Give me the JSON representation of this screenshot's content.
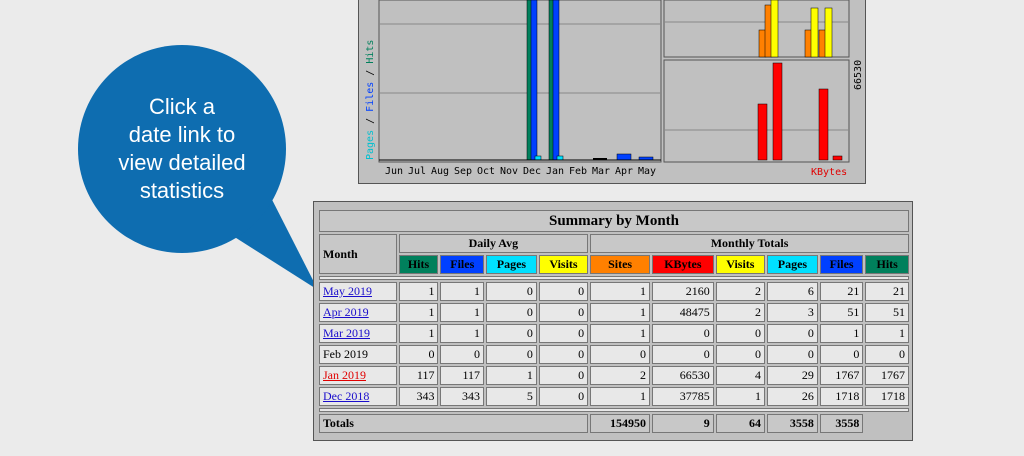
{
  "chart": {
    "y_legend": {
      "pages": "Pages",
      "sep1": " / ",
      "files": "Files",
      "sep2": " / ",
      "hits": "Hits"
    },
    "months": [
      "Jun",
      "Jul",
      "Aug",
      "Sep",
      "Oct",
      "Nov",
      "Dec",
      "Jan",
      "Feb",
      "Mar",
      "Apr",
      "May"
    ],
    "kbytes_label": "KBytes",
    "kbytes_scale": "66530"
  },
  "callout": {
    "line1": "Click a",
    "line2": "date link to",
    "line3": "view detailed",
    "line4": "statistics"
  },
  "summary": {
    "title": "Summary by Month",
    "month_header": "Month",
    "daily_avg": "Daily Avg",
    "monthly_totals": "Monthly Totals",
    "cols": {
      "d_hits": "Hits",
      "d_files": "Files",
      "d_pages": "Pages",
      "d_visits": "Visits",
      "m_sites": "Sites",
      "m_kbytes": "KBytes",
      "m_visits": "Visits",
      "m_pages": "Pages",
      "m_files": "Files",
      "m_hits": "Hits"
    },
    "colors": {
      "hits": "#00805c",
      "files": "#0040ff",
      "pages": "#00e0ff",
      "visits": "#ffff00",
      "sites": "#ff8000",
      "kbytes": "#ff0000"
    },
    "rows": [
      {
        "month": "May 2019",
        "d_hits": "1",
        "d_files": "1",
        "d_pages": "0",
        "d_visits": "0",
        "sites": "1",
        "kbytes": "2160",
        "visits": "2",
        "pages": "6",
        "files": "21",
        "hits": "21"
      },
      {
        "month": "Apr 2019",
        "d_hits": "1",
        "d_files": "1",
        "d_pages": "0",
        "d_visits": "0",
        "sites": "1",
        "kbytes": "48475",
        "visits": "2",
        "pages": "3",
        "files": "51",
        "hits": "51"
      },
      {
        "month": "Mar 2019",
        "d_hits": "1",
        "d_files": "1",
        "d_pages": "0",
        "d_visits": "0",
        "sites": "1",
        "kbytes": "0",
        "visits": "0",
        "pages": "0",
        "files": "1",
        "hits": "1"
      },
      {
        "month": "Feb 2019",
        "d_hits": "0",
        "d_files": "0",
        "d_pages": "0",
        "d_visits": "0",
        "sites": "0",
        "kbytes": "0",
        "visits": "0",
        "pages": "0",
        "files": "0",
        "hits": "0"
      },
      {
        "month": "Jan 2019",
        "d_hits": "117",
        "d_files": "117",
        "d_pages": "1",
        "d_visits": "0",
        "sites": "2",
        "kbytes": "66530",
        "visits": "4",
        "pages": "29",
        "files": "1767",
        "hits": "1767"
      },
      {
        "month": "Dec 2018",
        "d_hits": "343",
        "d_files": "343",
        "d_pages": "5",
        "d_visits": "0",
        "sites": "1",
        "kbytes": "37785",
        "visits": "1",
        "pages": "26",
        "files": "1718",
        "hits": "1718"
      }
    ],
    "totals": {
      "label": "Totals",
      "kbytes": "154950",
      "visits": "9",
      "pages": "64",
      "files": "3558",
      "hits": "3558"
    }
  }
}
